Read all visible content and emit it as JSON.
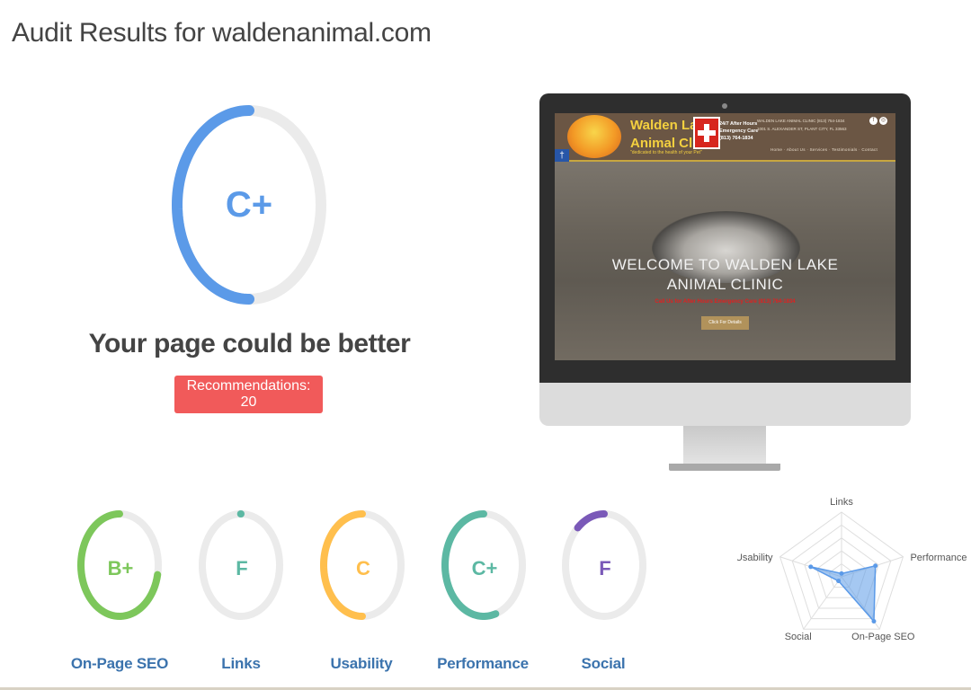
{
  "page": {
    "title": "Audit Results for waldenanimal.com"
  },
  "overall": {
    "grade": "C+",
    "percent": 0.5,
    "color": "#5b9ae8",
    "headline": "Your page could be better",
    "recommendations_label": "Recommendations: 20",
    "button_color": "#f15a5a"
  },
  "preview": {
    "site_name_line1": "Walden La",
    "site_name_line2": "Animal Cli",
    "tagline": "\"dedicated to the health of your Pet\"",
    "afterhours": [
      "24/7 After Hours",
      "Emergency Care",
      "(813) 764-1834"
    ],
    "address": [
      "WALDEN LAKE ANIMAL CLINIC  (813) 754-1834",
      "1001 S. ALEXANDER ST, PLANT CITY, FL 33563"
    ],
    "nav": "Home · About Us · Services · Testimonials · Contact",
    "hero_title_line1": "WELCOME TO WALDEN LAKE",
    "hero_title_line2": "ANIMAL CLINIC",
    "hero_subtitle": "Call Us for After Hours Emergency Care (813) 764-1834",
    "hero_button": "Click For Details"
  },
  "categories": [
    {
      "label": "On-Page SEO",
      "grade": "B+",
      "percent": 0.72,
      "color": "#7dc75b"
    },
    {
      "label": "Links",
      "grade": "F",
      "percent": 0.0,
      "color": "#5cb8a3"
    },
    {
      "label": "Usability",
      "grade": "C",
      "percent": 0.5,
      "color": "#ffbf4d"
    },
    {
      "label": "Performance",
      "grade": "C+",
      "percent": 0.55,
      "color": "#5cb8a3"
    },
    {
      "label": "Social",
      "grade": "F",
      "percent": 0.12,
      "color": "#7a59b8"
    }
  ],
  "radar": {
    "axes": [
      "Links",
      "Performance",
      "On-Page SEO",
      "Social",
      "Usability"
    ],
    "values": [
      0.05,
      0.55,
      0.85,
      0.08,
      0.5
    ],
    "color": "#5b9ae8"
  }
}
